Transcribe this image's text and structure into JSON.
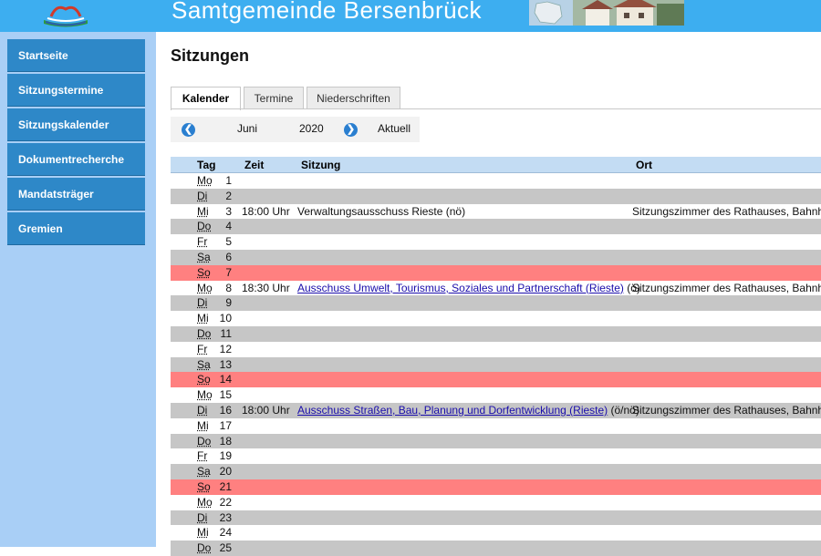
{
  "header": {
    "site_title": "Samtgemeinde Bersenbrück"
  },
  "sidebar": {
    "items": [
      {
        "label": "Startseite"
      },
      {
        "label": "Sitzungstermine"
      },
      {
        "label": "Sitzungskalender"
      },
      {
        "label": "Dokumentrecherche"
      },
      {
        "label": "Mandatsträger"
      },
      {
        "label": "Gremien"
      }
    ]
  },
  "main": {
    "title": "Sitzungen",
    "tabs": [
      {
        "label": "Kalender",
        "active": true
      },
      {
        "label": "Termine",
        "active": false
      },
      {
        "label": "Niederschriften",
        "active": false
      }
    ],
    "month_nav": {
      "month": "Juni",
      "year": "2020",
      "current_label": "Aktuell"
    },
    "table": {
      "headers": {
        "tag": "Tag",
        "zeit": "Zeit",
        "sitzung": "Sitzung",
        "ort": "Ort"
      },
      "rows": [
        {
          "wd": "Mo",
          "day": "1",
          "type": "white",
          "time": "",
          "title": "",
          "suffix": "",
          "place": ""
        },
        {
          "wd": "Di",
          "day": "2",
          "type": "gray",
          "time": "",
          "title": "",
          "suffix": "",
          "place": ""
        },
        {
          "wd": "Mi",
          "day": "3",
          "type": "white",
          "time": "18:00 Uhr",
          "title": "Verwaltungsausschuss Rieste (nö)",
          "link": false,
          "suffix": "",
          "place": "Sitzungszimmer des Rathauses, Bahnho"
        },
        {
          "wd": "Do",
          "day": "4",
          "type": "gray",
          "time": "",
          "title": "",
          "suffix": "",
          "place": ""
        },
        {
          "wd": "Fr",
          "day": "5",
          "type": "white",
          "time": "",
          "title": "",
          "suffix": "",
          "place": ""
        },
        {
          "wd": "Sa",
          "day": "6",
          "type": "gray",
          "time": "",
          "title": "",
          "suffix": "",
          "place": ""
        },
        {
          "wd": "So",
          "day": "7",
          "type": "sun",
          "time": "",
          "title": "",
          "suffix": "",
          "place": ""
        },
        {
          "wd": "Mo",
          "day": "8",
          "type": "white",
          "time": "18:30 Uhr",
          "title": "Ausschuss Umwelt, Tourismus, Soziales und Partnerschaft (Rieste)",
          "link": true,
          "suffix": " (ö)",
          "place": "Sitzungszimmer des Rathauses, Bahnho"
        },
        {
          "wd": "Di",
          "day": "9",
          "type": "gray",
          "time": "",
          "title": "",
          "suffix": "",
          "place": ""
        },
        {
          "wd": "Mi",
          "day": "10",
          "type": "white",
          "time": "",
          "title": "",
          "suffix": "",
          "place": ""
        },
        {
          "wd": "Do",
          "day": "11",
          "type": "gray",
          "time": "",
          "title": "",
          "suffix": "",
          "place": ""
        },
        {
          "wd": "Fr",
          "day": "12",
          "type": "white",
          "time": "",
          "title": "",
          "suffix": "",
          "place": ""
        },
        {
          "wd": "Sa",
          "day": "13",
          "type": "gray",
          "time": "",
          "title": "",
          "suffix": "",
          "place": ""
        },
        {
          "wd": "So",
          "day": "14",
          "type": "sun",
          "time": "",
          "title": "",
          "suffix": "",
          "place": ""
        },
        {
          "wd": "Mo",
          "day": "15",
          "type": "white",
          "time": "",
          "title": "",
          "suffix": "",
          "place": ""
        },
        {
          "wd": "Di",
          "day": "16",
          "type": "gray",
          "time": "18:00 Uhr",
          "title": "Ausschuss Straßen, Bau, Planung und Dorfentwicklung (Rieste)",
          "link": true,
          "suffix": " (ö/nö)",
          "place": "Sitzungszimmer des Rathauses, Bahnho"
        },
        {
          "wd": "Mi",
          "day": "17",
          "type": "white",
          "time": "",
          "title": "",
          "suffix": "",
          "place": ""
        },
        {
          "wd": "Do",
          "day": "18",
          "type": "gray",
          "time": "",
          "title": "",
          "suffix": "",
          "place": ""
        },
        {
          "wd": "Fr",
          "day": "19",
          "type": "white",
          "time": "",
          "title": "",
          "suffix": "",
          "place": ""
        },
        {
          "wd": "Sa",
          "day": "20",
          "type": "gray",
          "time": "",
          "title": "",
          "suffix": "",
          "place": ""
        },
        {
          "wd": "So",
          "day": "21",
          "type": "sun",
          "time": "",
          "title": "",
          "suffix": "",
          "place": ""
        },
        {
          "wd": "Mo",
          "day": "22",
          "type": "white",
          "time": "",
          "title": "",
          "suffix": "",
          "place": ""
        },
        {
          "wd": "Di",
          "day": "23",
          "type": "gray",
          "time": "",
          "title": "",
          "suffix": "",
          "place": ""
        },
        {
          "wd": "Mi",
          "day": "24",
          "type": "white",
          "time": "",
          "title": "",
          "suffix": "",
          "place": ""
        },
        {
          "wd": "Do",
          "day": "25",
          "type": "gray",
          "time": "",
          "title": "",
          "suffix": "",
          "place": ""
        }
      ]
    }
  },
  "colors": {
    "header_bg": "#3daef0",
    "sidebar_bg": "#a9cff6",
    "nav_item_bg": "#2e88c8",
    "row_gray": "#c6c6c6",
    "row_sunday": "#ff8080",
    "table_header_bg": "#c3dcf3",
    "nav_arrow": "#2a7fd0"
  },
  "icons": {
    "prev_month": "chevron-left-icon",
    "next_month": "chevron-right-icon"
  }
}
